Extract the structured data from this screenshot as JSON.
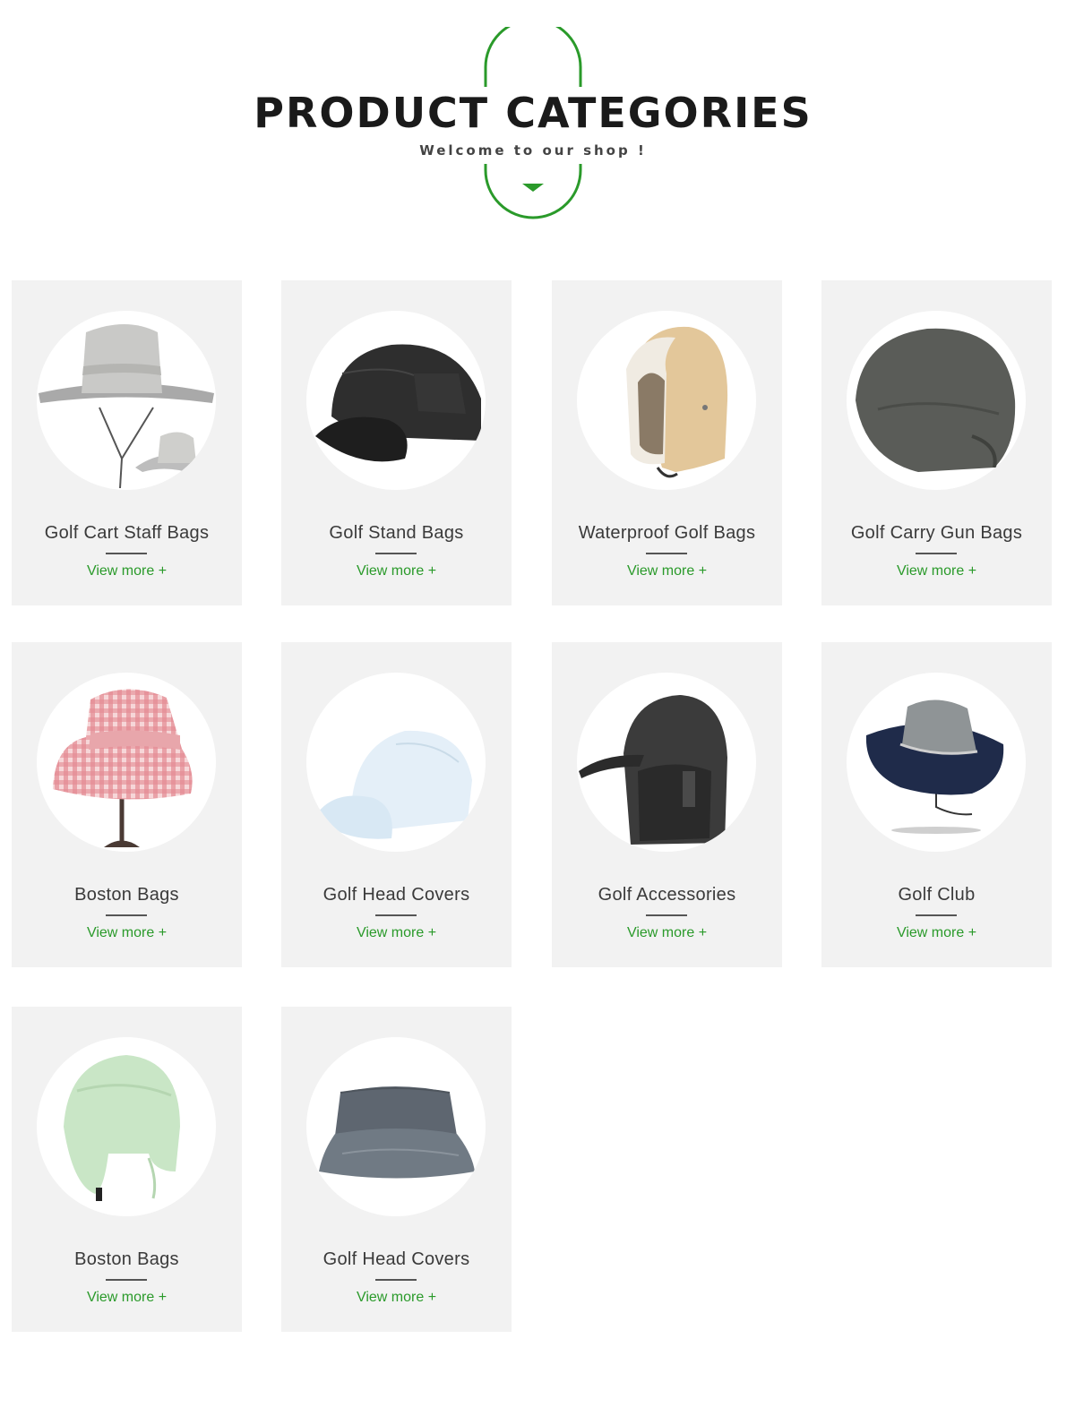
{
  "header": {
    "title": "PRODUCT CATEGORIES",
    "subtitle": "Welcome to our shop !"
  },
  "colors": {
    "accent_green": "#2a9a2a",
    "card_background": "#f2f2f2",
    "title_text": "#1a1a1a"
  },
  "categories": [
    {
      "title": "Golf Cart Staff Bags",
      "link": "View more +",
      "image": "grey-wide-brim-sun-hat-icon"
    },
    {
      "title": "Golf Stand Bags",
      "link": "View more +",
      "image": "black-baseball-cap-icon"
    },
    {
      "title": "Waterproof Golf Bags",
      "link": "View more +",
      "image": "tan-fleece-trapper-hat-icon"
    },
    {
      "title": "Golf Carry Gun Bags",
      "link": "View more +",
      "image": "dark-grey-bucket-hat-icon"
    },
    {
      "title": "Boston Bags",
      "link": "View more +",
      "image": "pink-gingham-bucket-hat-icon"
    },
    {
      "title": "Golf Head Covers",
      "link": "View more +",
      "image": "light-blue-baseball-cap-icon"
    },
    {
      "title": "Golf Accessories",
      "link": "View more +",
      "image": "black-ear-flap-cap-icon"
    },
    {
      "title": "Golf Club",
      "link": "View more +",
      "image": "navy-grey-boonie-hat-icon"
    },
    {
      "title": "Boston Bags",
      "link": "View more +",
      "image": "mint-green-trapper-hat-icon"
    },
    {
      "title": "Golf Head Covers",
      "link": "View more +",
      "image": "washed-denim-bucket-hat-icon"
    }
  ]
}
